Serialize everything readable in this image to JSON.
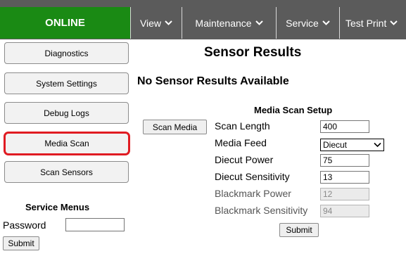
{
  "nav": {
    "status": "ONLINE",
    "menus": [
      {
        "label": "View"
      },
      {
        "label": "Maintenance"
      },
      {
        "label": "Service"
      },
      {
        "label": "Test Print"
      }
    ]
  },
  "sidebar": {
    "buttons": [
      {
        "label": "Diagnostics"
      },
      {
        "label": "System Settings"
      },
      {
        "label": "Debug Logs"
      },
      {
        "label": "Media Scan",
        "active": true
      },
      {
        "label": "Scan Sensors"
      }
    ],
    "service_menus": {
      "title": "Service Menus",
      "password_label": "Password",
      "password_value": "",
      "submit_label": "Submit"
    }
  },
  "main": {
    "title": "Sensor Results",
    "no_results": "No Sensor Results Available",
    "scan_media_label": "Scan Media",
    "setup": {
      "title": "Media Scan Setup",
      "scan_length": {
        "label": "Scan Length",
        "value": "400"
      },
      "media_feed": {
        "label": "Media Feed",
        "value": "Diecut"
      },
      "diecut_power": {
        "label": "Diecut Power",
        "value": "75"
      },
      "diecut_sensitivity": {
        "label": "Diecut Sensitivity",
        "value": "13"
      },
      "blackmark_power": {
        "label": "Blackmark Power",
        "value": "12"
      },
      "blackmark_sensitivity": {
        "label": "Blackmark Sensitivity",
        "value": "94"
      },
      "submit_label": "Submit"
    }
  },
  "colors": {
    "status_green": "#1a8a14",
    "nav_gray": "#5b5b5b",
    "active_outline": "#e01b22"
  }
}
